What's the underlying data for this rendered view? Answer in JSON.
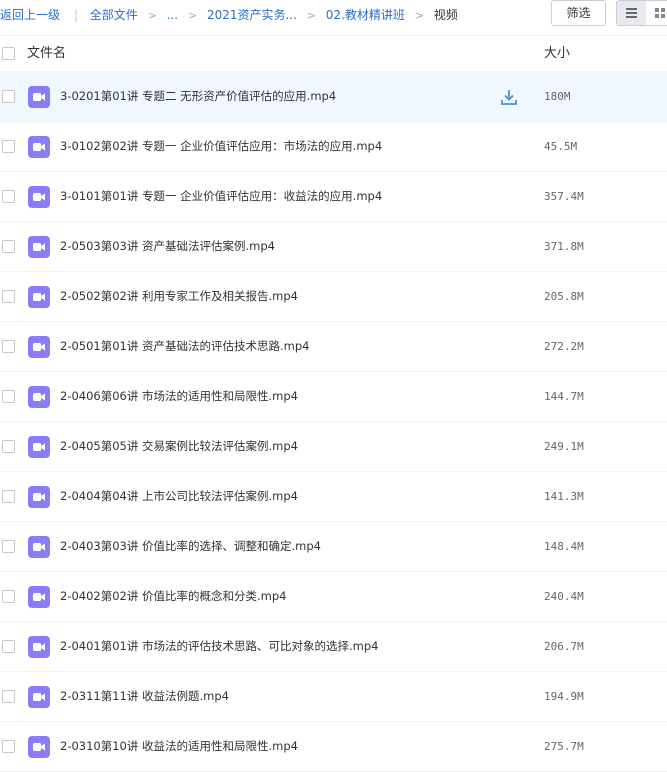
{
  "breadcrumb": {
    "back": "返回上一级",
    "all_files": "全部文件",
    "ellipsis": "...",
    "folder_1": "2021资产实务...",
    "folder_2": "02.教材精讲班",
    "current": "视频"
  },
  "toolbar": {
    "filter_label": "筛选",
    "view_list_icon": "list-view-icon",
    "view_grid_icon": "grid-view-icon"
  },
  "table": {
    "col_name": "文件名",
    "col_size": "大小"
  },
  "colors": {
    "accent": "#2d6ec9",
    "video_icon": "#8a7cf6",
    "download_icon": "#4a90d9",
    "row_highlight": "#f1f7fe"
  },
  "files": [
    {
      "name": "3-0201第01讲  专题二 无形资产价值评估的应用.mp4",
      "size": "180M",
      "icon": "video-file-icon"
    },
    {
      "name": "3-0102第02讲  专题一 企业价值评估应用：市场法的应用.mp4",
      "size": "45.5M",
      "icon": "video-file-icon"
    },
    {
      "name": "3-0101第01讲  专题一 企业价值评估应用：收益法的应用.mp4",
      "size": "357.4M",
      "icon": "video-file-icon"
    },
    {
      "name": "2-0503第03讲  资产基础法评估案例.mp4",
      "size": "371.8M",
      "icon": "video-file-icon"
    },
    {
      "name": "2-0502第02讲  利用专家工作及相关报告.mp4",
      "size": "205.8M",
      "icon": "video-file-icon"
    },
    {
      "name": "2-0501第01讲  资产基础法的评估技术思路.mp4",
      "size": "272.2M",
      "icon": "video-file-icon"
    },
    {
      "name": "2-0406第06讲  市场法的适用性和局限性.mp4",
      "size": "144.7M",
      "icon": "video-file-icon"
    },
    {
      "name": "2-0405第05讲  交易案例比较法评估案例.mp4",
      "size": "249.1M",
      "icon": "video-file-icon"
    },
    {
      "name": "2-0404第04讲  上市公司比较法评估案例.mp4",
      "size": "141.3M",
      "icon": "video-file-icon"
    },
    {
      "name": "2-0403第03讲  价值比率的选择、调整和确定.mp4",
      "size": "148.4M",
      "icon": "video-file-icon"
    },
    {
      "name": "2-0402第02讲  价值比率的概念和分类.mp4",
      "size": "240.4M",
      "icon": "video-file-icon"
    },
    {
      "name": "2-0401第01讲  市场法的评估技术思路、可比对象的选择.mp4",
      "size": "206.7M",
      "icon": "video-file-icon"
    },
    {
      "name": "2-0311第11讲  收益法例题.mp4",
      "size": "194.9M",
      "icon": "video-file-icon"
    },
    {
      "name": "2-0310第10讲  收益法的适用性和局限性.mp4",
      "size": "275.7M",
      "icon": "video-file-icon"
    }
  ]
}
